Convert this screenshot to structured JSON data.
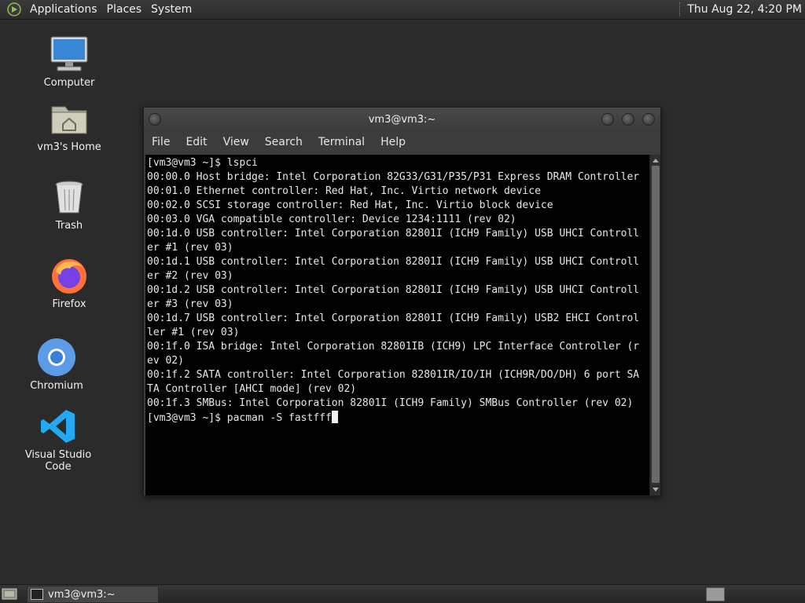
{
  "top_panel": {
    "menus": [
      "Applications",
      "Places",
      "System"
    ],
    "clock": "Thu Aug 22,  4:20 PM"
  },
  "desktop_icons": [
    {
      "label": "Computer",
      "icon": "computer-icon"
    },
    {
      "label": "vm3's Home",
      "icon": "home-folder-icon"
    },
    {
      "label": "Trash",
      "icon": "trash-icon"
    },
    {
      "label": "Firefox",
      "icon": "firefox-icon"
    },
    {
      "label": "Chromium",
      "icon": "chromium-icon"
    },
    {
      "label": "Visual Studio Code",
      "icon": "vscode-icon"
    }
  ],
  "terminal": {
    "title": "vm3@vm3:~",
    "menu": [
      "File",
      "Edit",
      "View",
      "Search",
      "Terminal",
      "Help"
    ],
    "lines": [
      "[vm3@vm3 ~]$ lspci",
      "00:00.0 Host bridge: Intel Corporation 82G33/G31/P35/P31 Express DRAM Controller",
      "00:01.0 Ethernet controller: Red Hat, Inc. Virtio network device",
      "00:02.0 SCSI storage controller: Red Hat, Inc. Virtio block device",
      "00:03.0 VGA compatible controller: Device 1234:1111 (rev 02)",
      "00:1d.0 USB controller: Intel Corporation 82801I (ICH9 Family) USB UHCI Controll",
      "er #1 (rev 03)",
      "00:1d.1 USB controller: Intel Corporation 82801I (ICH9 Family) USB UHCI Controll",
      "er #2 (rev 03)",
      "00:1d.2 USB controller: Intel Corporation 82801I (ICH9 Family) USB UHCI Controll",
      "er #3 (rev 03)",
      "00:1d.7 USB controller: Intel Corporation 82801I (ICH9 Family) USB2 EHCI Control",
      "ler #1 (rev 03)",
      "00:1f.0 ISA bridge: Intel Corporation 82801IB (ICH9) LPC Interface Controller (r",
      "ev 02)",
      "00:1f.2 SATA controller: Intel Corporation 82801IR/IO/IH (ICH9R/DO/DH) 6 port SA",
      "TA Controller [AHCI mode] (rev 02)",
      "00:1f.3 SMBus: Intel Corporation 82801I (ICH9 Family) SMBus Controller (rev 02)"
    ],
    "prompt": "[vm3@vm3 ~]$ ",
    "current_input": "pacman -S fastfff"
  },
  "taskbar": {
    "window_button": "vm3@vm3:~"
  }
}
